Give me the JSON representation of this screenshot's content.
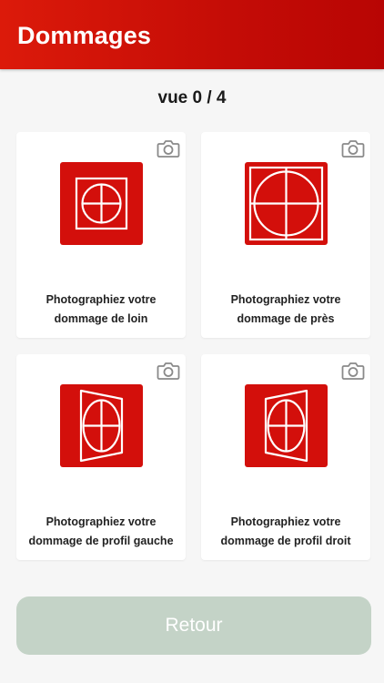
{
  "header": {
    "title": "Dommages"
  },
  "progress": {
    "label": "vue 0 / 4",
    "done": 0,
    "total": 4
  },
  "cards": [
    {
      "line1": "Photographiez votre",
      "line2": "dommage de loin",
      "icon": "camera-icon",
      "pictogram": "target-far-icon"
    },
    {
      "line1": "Photographiez votre",
      "line2": "dommage de près",
      "icon": "camera-icon",
      "pictogram": "target-near-icon"
    },
    {
      "line1": "Photographiez votre",
      "line2": "dommage de profil gauche",
      "icon": "camera-icon",
      "pictogram": "target-left-profile-icon"
    },
    {
      "line1": "Photographiez votre",
      "line2": "dommage de profil droit",
      "icon": "camera-icon",
      "pictogram": "target-right-profile-icon"
    }
  ],
  "footer": {
    "back_label": "Retour"
  },
  "colors": {
    "brand_red": "#d30f0b",
    "button_disabled": "#c4d3c7",
    "background": "#f6f6f6"
  }
}
